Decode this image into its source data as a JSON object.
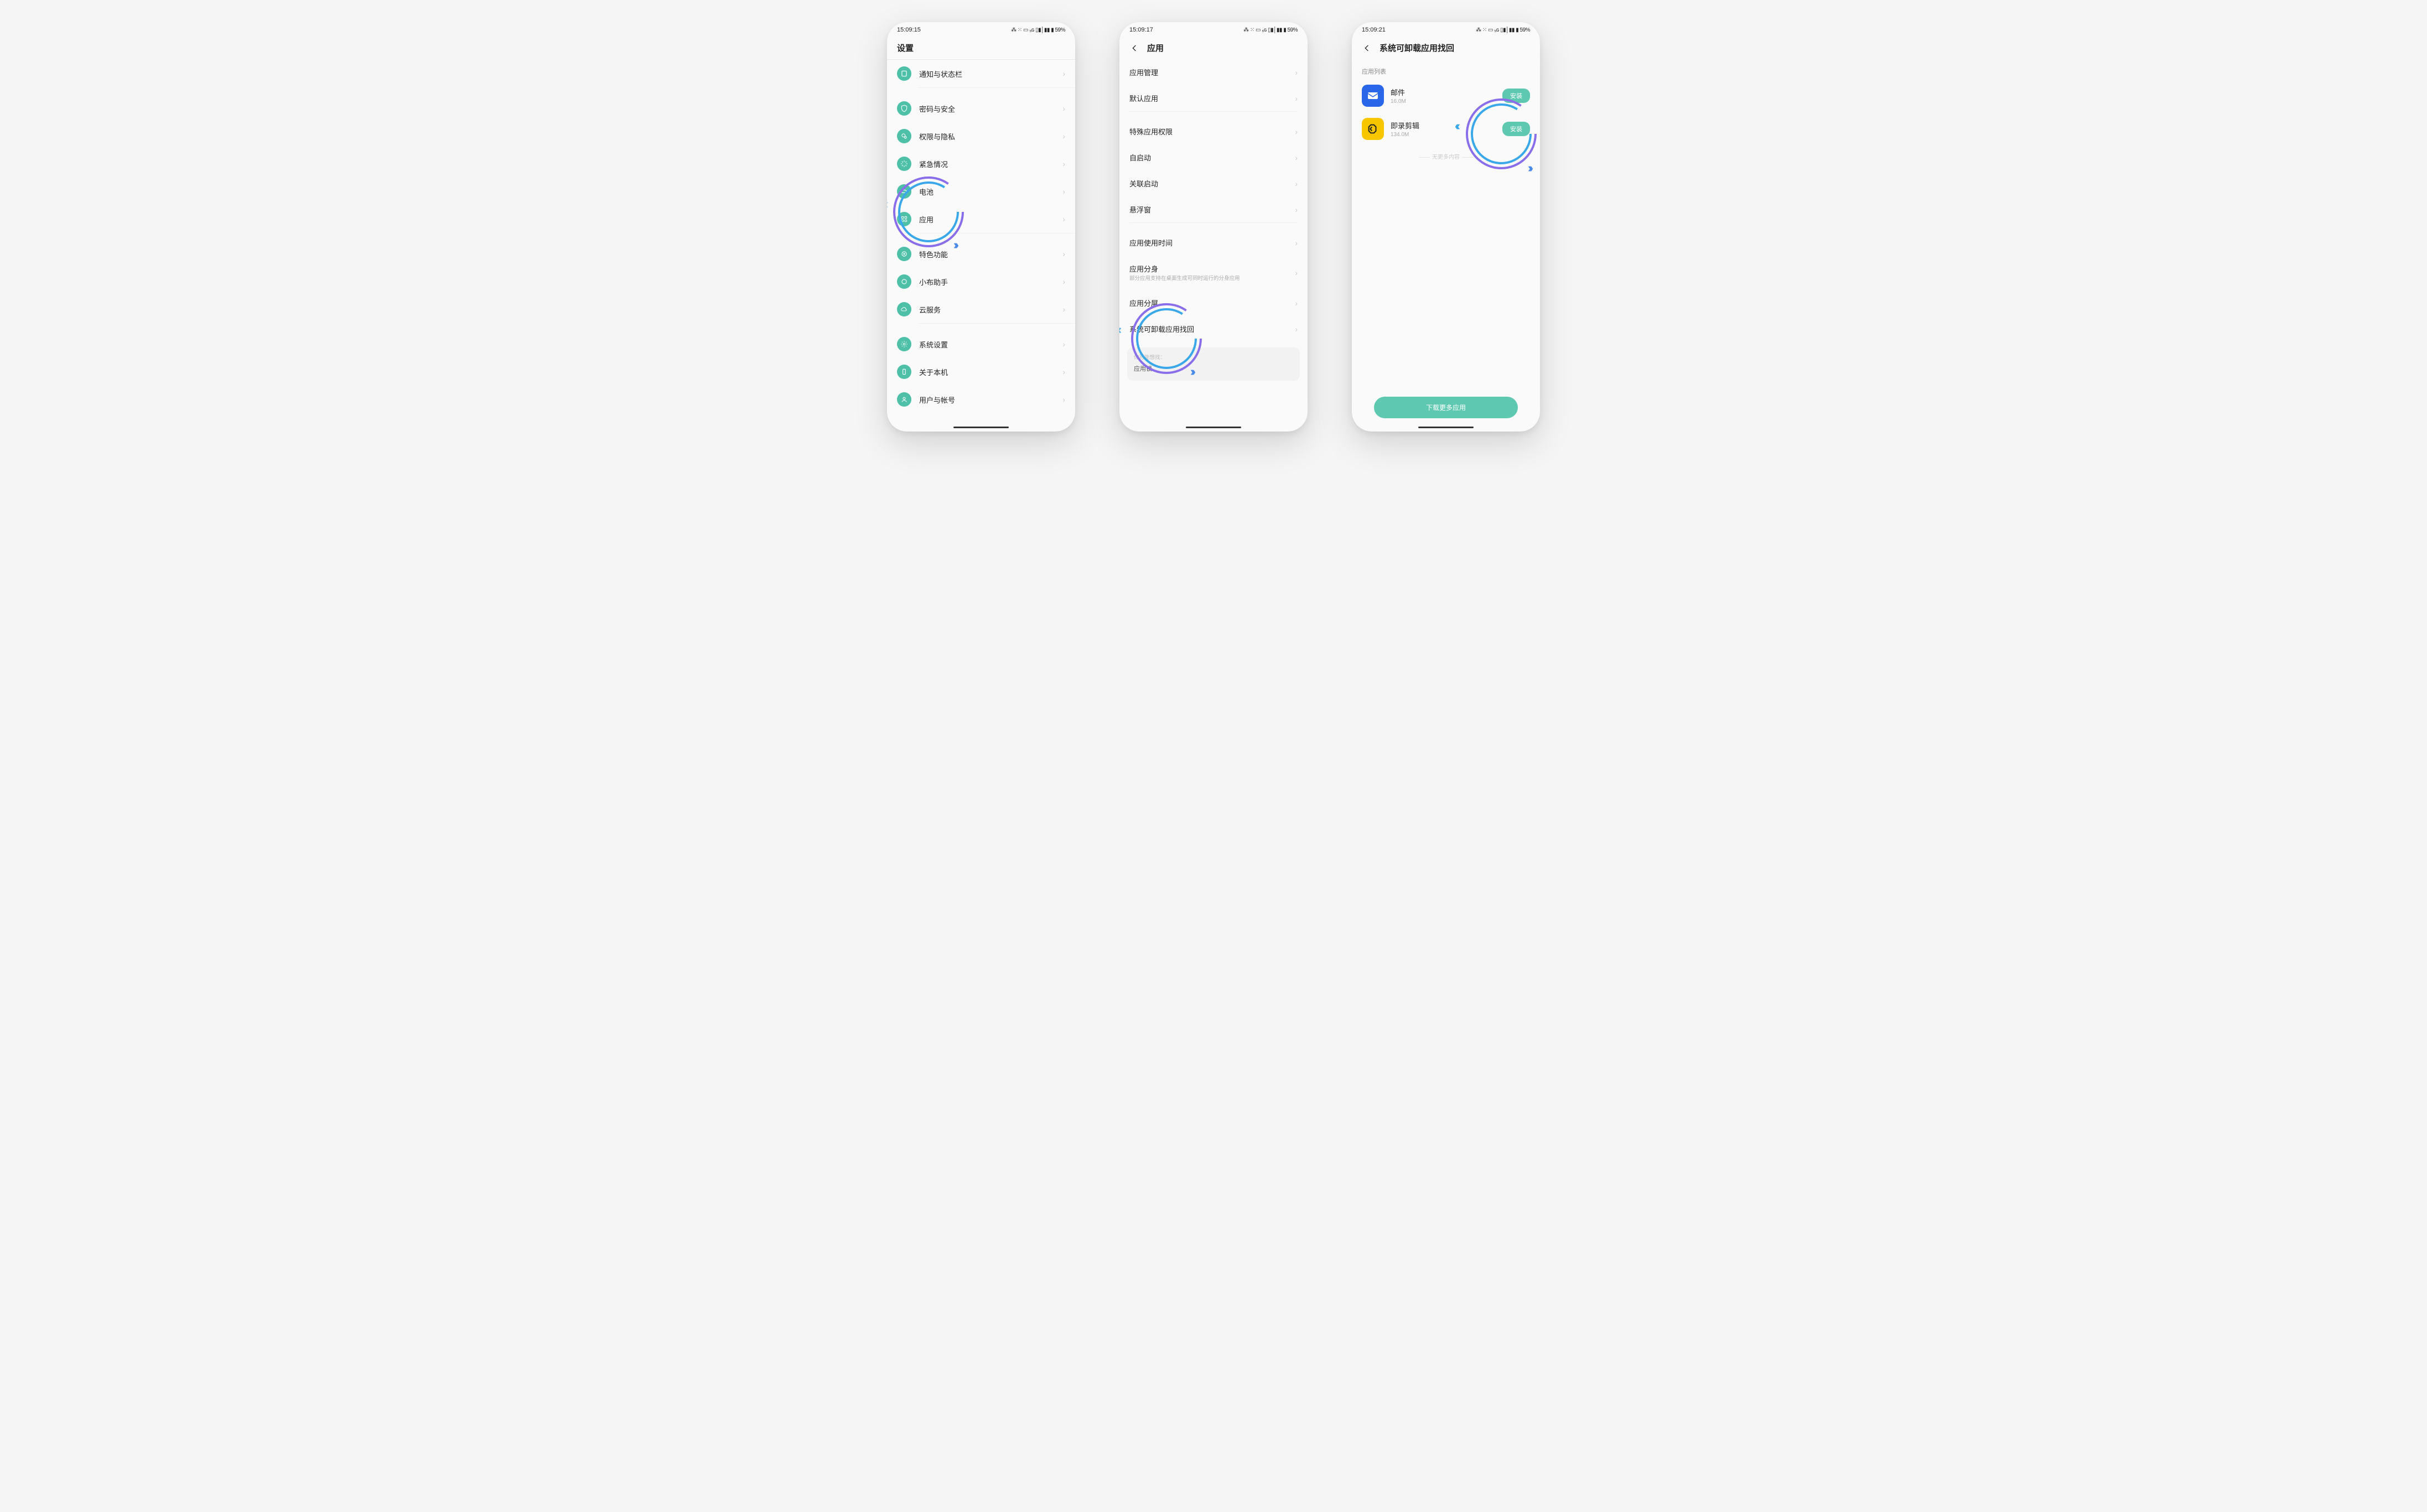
{
  "status": {
    "time1": "15:09:15",
    "time2": "15:09:17",
    "time3": "15:09:21",
    "indicators": "⁂ ⁙ ▭ ₅ɢ ▯▮│▮▮ ▮ 59%"
  },
  "screen1": {
    "title": "设置",
    "items": [
      {
        "label": "通知与状态栏"
      },
      {
        "label": "密码与安全"
      },
      {
        "label": "权限与隐私"
      },
      {
        "label": "紧急情况"
      },
      {
        "label": "电池"
      },
      {
        "label": "应用"
      },
      {
        "label": "特色功能"
      },
      {
        "label": "小布助手"
      },
      {
        "label": "云服务"
      },
      {
        "label": "系统设置"
      },
      {
        "label": "关于本机"
      },
      {
        "label": "用户与帐号"
      }
    ]
  },
  "screen2": {
    "title": "应用",
    "items": [
      {
        "label": "应用管理"
      },
      {
        "label": "默认应用"
      },
      {
        "label": "特殊应用权限"
      },
      {
        "label": "自启动"
      },
      {
        "label": "关联启动"
      },
      {
        "label": "悬浮窗"
      },
      {
        "label": "应用使用时间"
      },
      {
        "label": "应用分身",
        "sub": "部分应用支持在桌面生成可同时运行的分身应用"
      },
      {
        "label": "应用分屏"
      },
      {
        "label": "系统可卸载应用找回"
      }
    ],
    "hint_title": "你可能想找：",
    "hint_item": "应用锁"
  },
  "screen3": {
    "title": "系统可卸载应用找回",
    "section": "应用列表",
    "apps": [
      {
        "name": "邮件",
        "size": "16.0M",
        "btn": "安装"
      },
      {
        "name": "即录剪辑",
        "size": "134.0M",
        "btn": "安装"
      }
    ],
    "no_more": "无更多内容",
    "bottom_btn": "下载更多应用"
  }
}
